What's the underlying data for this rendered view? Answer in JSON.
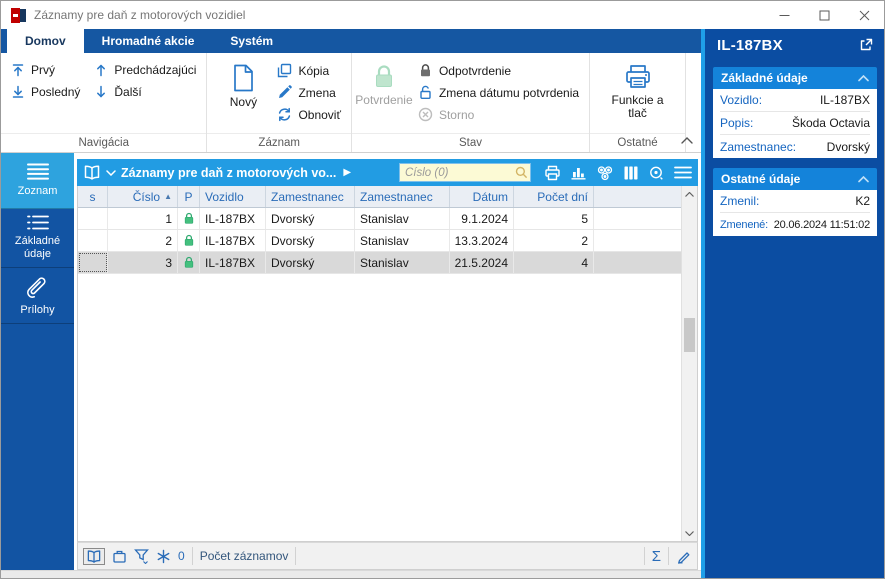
{
  "window": {
    "title": "Záznamy pre daň z motorových vozidiel"
  },
  "tabs": [
    {
      "label": "Domov",
      "active": true
    },
    {
      "label": "Hromadné akcie",
      "active": false
    },
    {
      "label": "Systém",
      "active": false
    }
  ],
  "ribbon": {
    "navigation": {
      "label": "Navigácia",
      "first": "Prvý",
      "last": "Posledný",
      "previous": "Predchádzajúci",
      "next": "Ďalší"
    },
    "record": {
      "label": "Záznam",
      "new": "Nový",
      "copy": "Kópia",
      "change": "Zmena",
      "refresh": "Obnoviť"
    },
    "state": {
      "label": "Stav",
      "confirm": "Potvrdenie",
      "unconfirm": "Odpotvrdenie",
      "change_date": "Zmena dátumu potvrdenia",
      "cancel": "Storno"
    },
    "other": {
      "label": "Ostatné",
      "functions": "Funkcie a tlač"
    }
  },
  "sidebar": {
    "items": [
      {
        "label": "Zoznam"
      },
      {
        "label": "Základné údaje"
      },
      {
        "label": "Prílohy"
      }
    ]
  },
  "toolbar": {
    "title": "Záznamy pre daň z motorových vo...",
    "search_placeholder": "Číslo (0)"
  },
  "table": {
    "columns": [
      "s",
      "Číslo",
      "P",
      "Vozidlo",
      "Zamestnanec",
      "Zamestnanec",
      "Dátum",
      "Počet dní"
    ],
    "sort_indicator": "▲",
    "rows": [
      {
        "cislo": "1",
        "vozidlo": "IL-187BX",
        "priezvisko": "Dvorský",
        "meno": "Stanislav",
        "datum": "9.1.2024",
        "pocet_dni": "5"
      },
      {
        "cislo": "2",
        "vozidlo": "IL-187BX",
        "priezvisko": "Dvorský",
        "meno": "Stanislav",
        "datum": "13.3.2024",
        "pocet_dni": "2"
      },
      {
        "cislo": "3",
        "vozidlo": "IL-187BX",
        "priezvisko": "Dvorský",
        "meno": "Stanislav",
        "datum": "21.5.2024",
        "pocet_dni": "4"
      }
    ]
  },
  "statusbar": {
    "filter_count": "0",
    "records_label": "Počet záznamov"
  },
  "icons": {
    "play": "▶",
    "sigma": "Σ"
  },
  "panel": {
    "title": "IL-187BX",
    "sections": [
      {
        "title": "Základné údaje",
        "rows": [
          {
            "label": "Vozidlo:",
            "value": "IL-187BX"
          },
          {
            "label": "Popis:",
            "value": "Škoda Octavia"
          },
          {
            "label": "Zamestnanec:",
            "value": "Dvorský"
          }
        ]
      },
      {
        "title": "Ostatné údaje",
        "rows": [
          {
            "label": "Zmenil:",
            "value": "K2"
          },
          {
            "label": "Zmenené:",
            "value": "20.06.2024 11:51:02"
          }
        ]
      }
    ]
  },
  "colors": {
    "tabbar_blue": "#1557a2",
    "toolbar_blue": "#229ce3",
    "sidebar_blue": "#1254a3",
    "sidebar_active": "#2ea3de",
    "panel_blue": "#0b4da2",
    "section_blue": "#1483da",
    "accent_cyan": "#1f9fe8",
    "label_blue": "#1565c0",
    "lock_green": "#44c07e",
    "search_yellow": "#fcfad5"
  }
}
